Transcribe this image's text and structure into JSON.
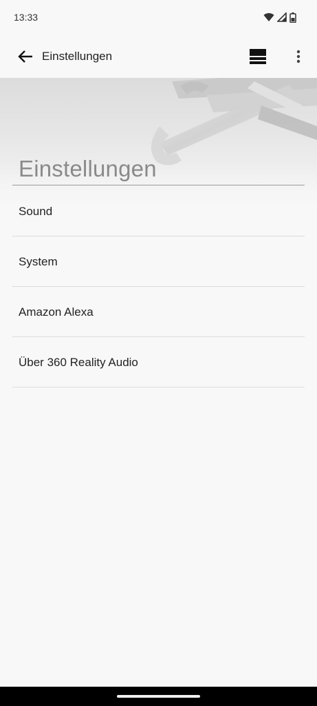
{
  "status_bar": {
    "time": "13:33",
    "icons": [
      "wifi-icon",
      "cell-signal-icon",
      "battery-icon"
    ]
  },
  "app_bar": {
    "title": "Einstellungen",
    "back_icon": "arrow-left-icon",
    "layout_icon": "layout-toggle-icon",
    "more_icon": "more-vert-icon"
  },
  "header": {
    "heading": "Einstellungen",
    "background_image": "wrenches-tools"
  },
  "menu": {
    "items": [
      {
        "label": "Sound"
      },
      {
        "label": "System"
      },
      {
        "label": "Amazon Alexa"
      },
      {
        "label": "Über 360 Reality Audio"
      }
    ]
  },
  "colors": {
    "background": "#f8f8f8",
    "divider": "#dcdcdc",
    "heading": "#8a8a8a",
    "nav_bar": "#000000"
  }
}
